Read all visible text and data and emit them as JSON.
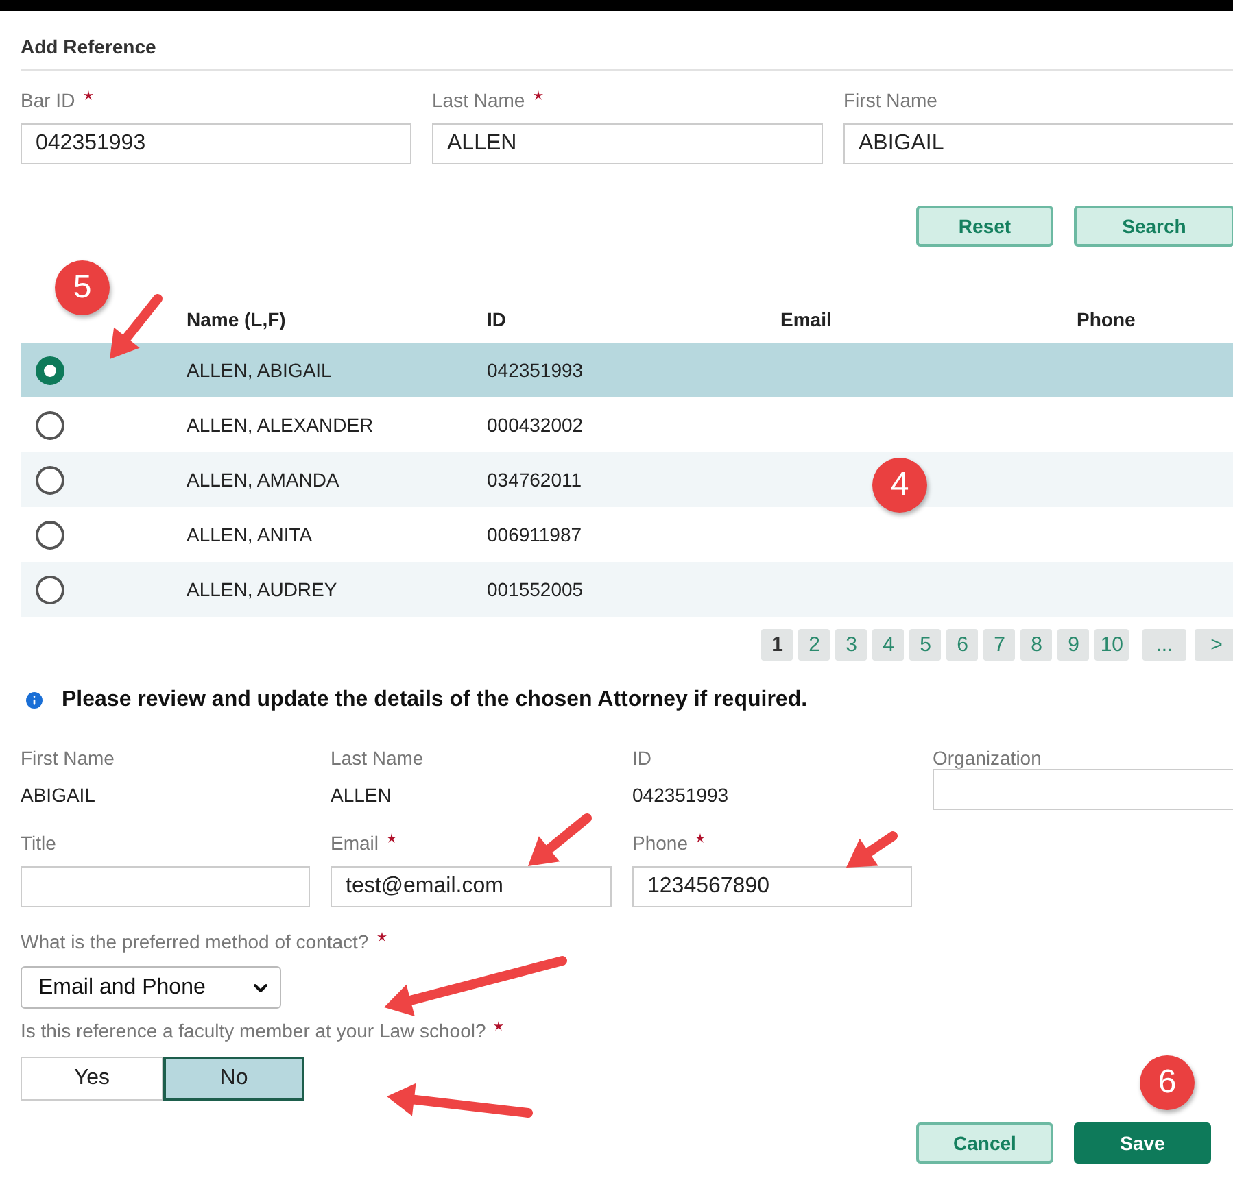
{
  "dialog": {
    "title": "Add Reference"
  },
  "search_fields": [
    {
      "label": "Bar ID",
      "required": true,
      "value": "042351993"
    },
    {
      "label": "Last Name",
      "required": true,
      "value": "ALLEN"
    },
    {
      "label": "First Name",
      "required": false,
      "value": "ABIGAIL"
    }
  ],
  "search_buttons": [
    "Reset",
    "Search"
  ],
  "table": {
    "columns": [
      "Name (L,F)",
      "ID",
      "Email",
      "Phone"
    ],
    "rows": [
      {
        "selected": true,
        "cells": [
          "ALLEN, ABIGAIL",
          "042351993"
        ]
      },
      {
        "selected": false,
        "cells": [
          "ALLEN, ALEXANDER",
          "000432002"
        ]
      },
      {
        "selected": false,
        "cells": [
          "ALLEN, AMANDA",
          "034762011"
        ]
      },
      {
        "selected": false,
        "cells": [
          "ALLEN, ANITA",
          "006911987"
        ]
      },
      {
        "selected": false,
        "cells": [
          "ALLEN, AUDREY",
          "001552005"
        ]
      }
    ]
  },
  "pagination": [
    {
      "label": "1",
      "selected": true
    },
    {
      "label": "2",
      "selected": false
    },
    {
      "label": "3",
      "selected": false
    },
    {
      "label": "4",
      "selected": false
    },
    {
      "label": "5",
      "selected": false
    },
    {
      "label": "6",
      "selected": false
    },
    {
      "label": "7",
      "selected": false
    },
    {
      "label": "8",
      "selected": false
    },
    {
      "label": "9",
      "selected": false
    },
    {
      "label": "10",
      "selected": false
    },
    {
      "label": "...",
      "selected": false
    },
    {
      "label": ">",
      "selected": false
    }
  ],
  "info": "Please review and update the details of the chosen Attorney if required.",
  "details": [
    {
      "label": "First Name",
      "value": "ABIGAIL",
      "kind": "text"
    },
    {
      "label": "Last Name",
      "value": "ALLEN",
      "kind": "text"
    },
    {
      "label": "ID",
      "value": "042351993",
      "kind": "text"
    },
    {
      "label": "Organization",
      "kind": "input"
    }
  ],
  "contact_fields": [
    {
      "label": "Title",
      "required": false
    },
    {
      "label": "Email",
      "required": true,
      "value": "test@email.com"
    },
    {
      "label": "Phone",
      "required": true,
      "value": "1234567890"
    }
  ],
  "contact_method": {
    "label": "What is the preferred method of contact?",
    "required": true,
    "value": "Email and Phone"
  },
  "faculty": {
    "label": "Is this reference a faculty member at your Law school?",
    "required": true,
    "options": [
      {
        "label": "Yes",
        "selected": false
      },
      {
        "label": "No",
        "selected": true
      }
    ]
  },
  "footer_buttons": [
    {
      "label": "Cancel",
      "kind": "secondary"
    },
    {
      "label": "Save",
      "kind": "primary"
    }
  ],
  "annotations": [
    {
      "label": "5"
    },
    {
      "label": "4"
    },
    {
      "label": "6"
    }
  ]
}
